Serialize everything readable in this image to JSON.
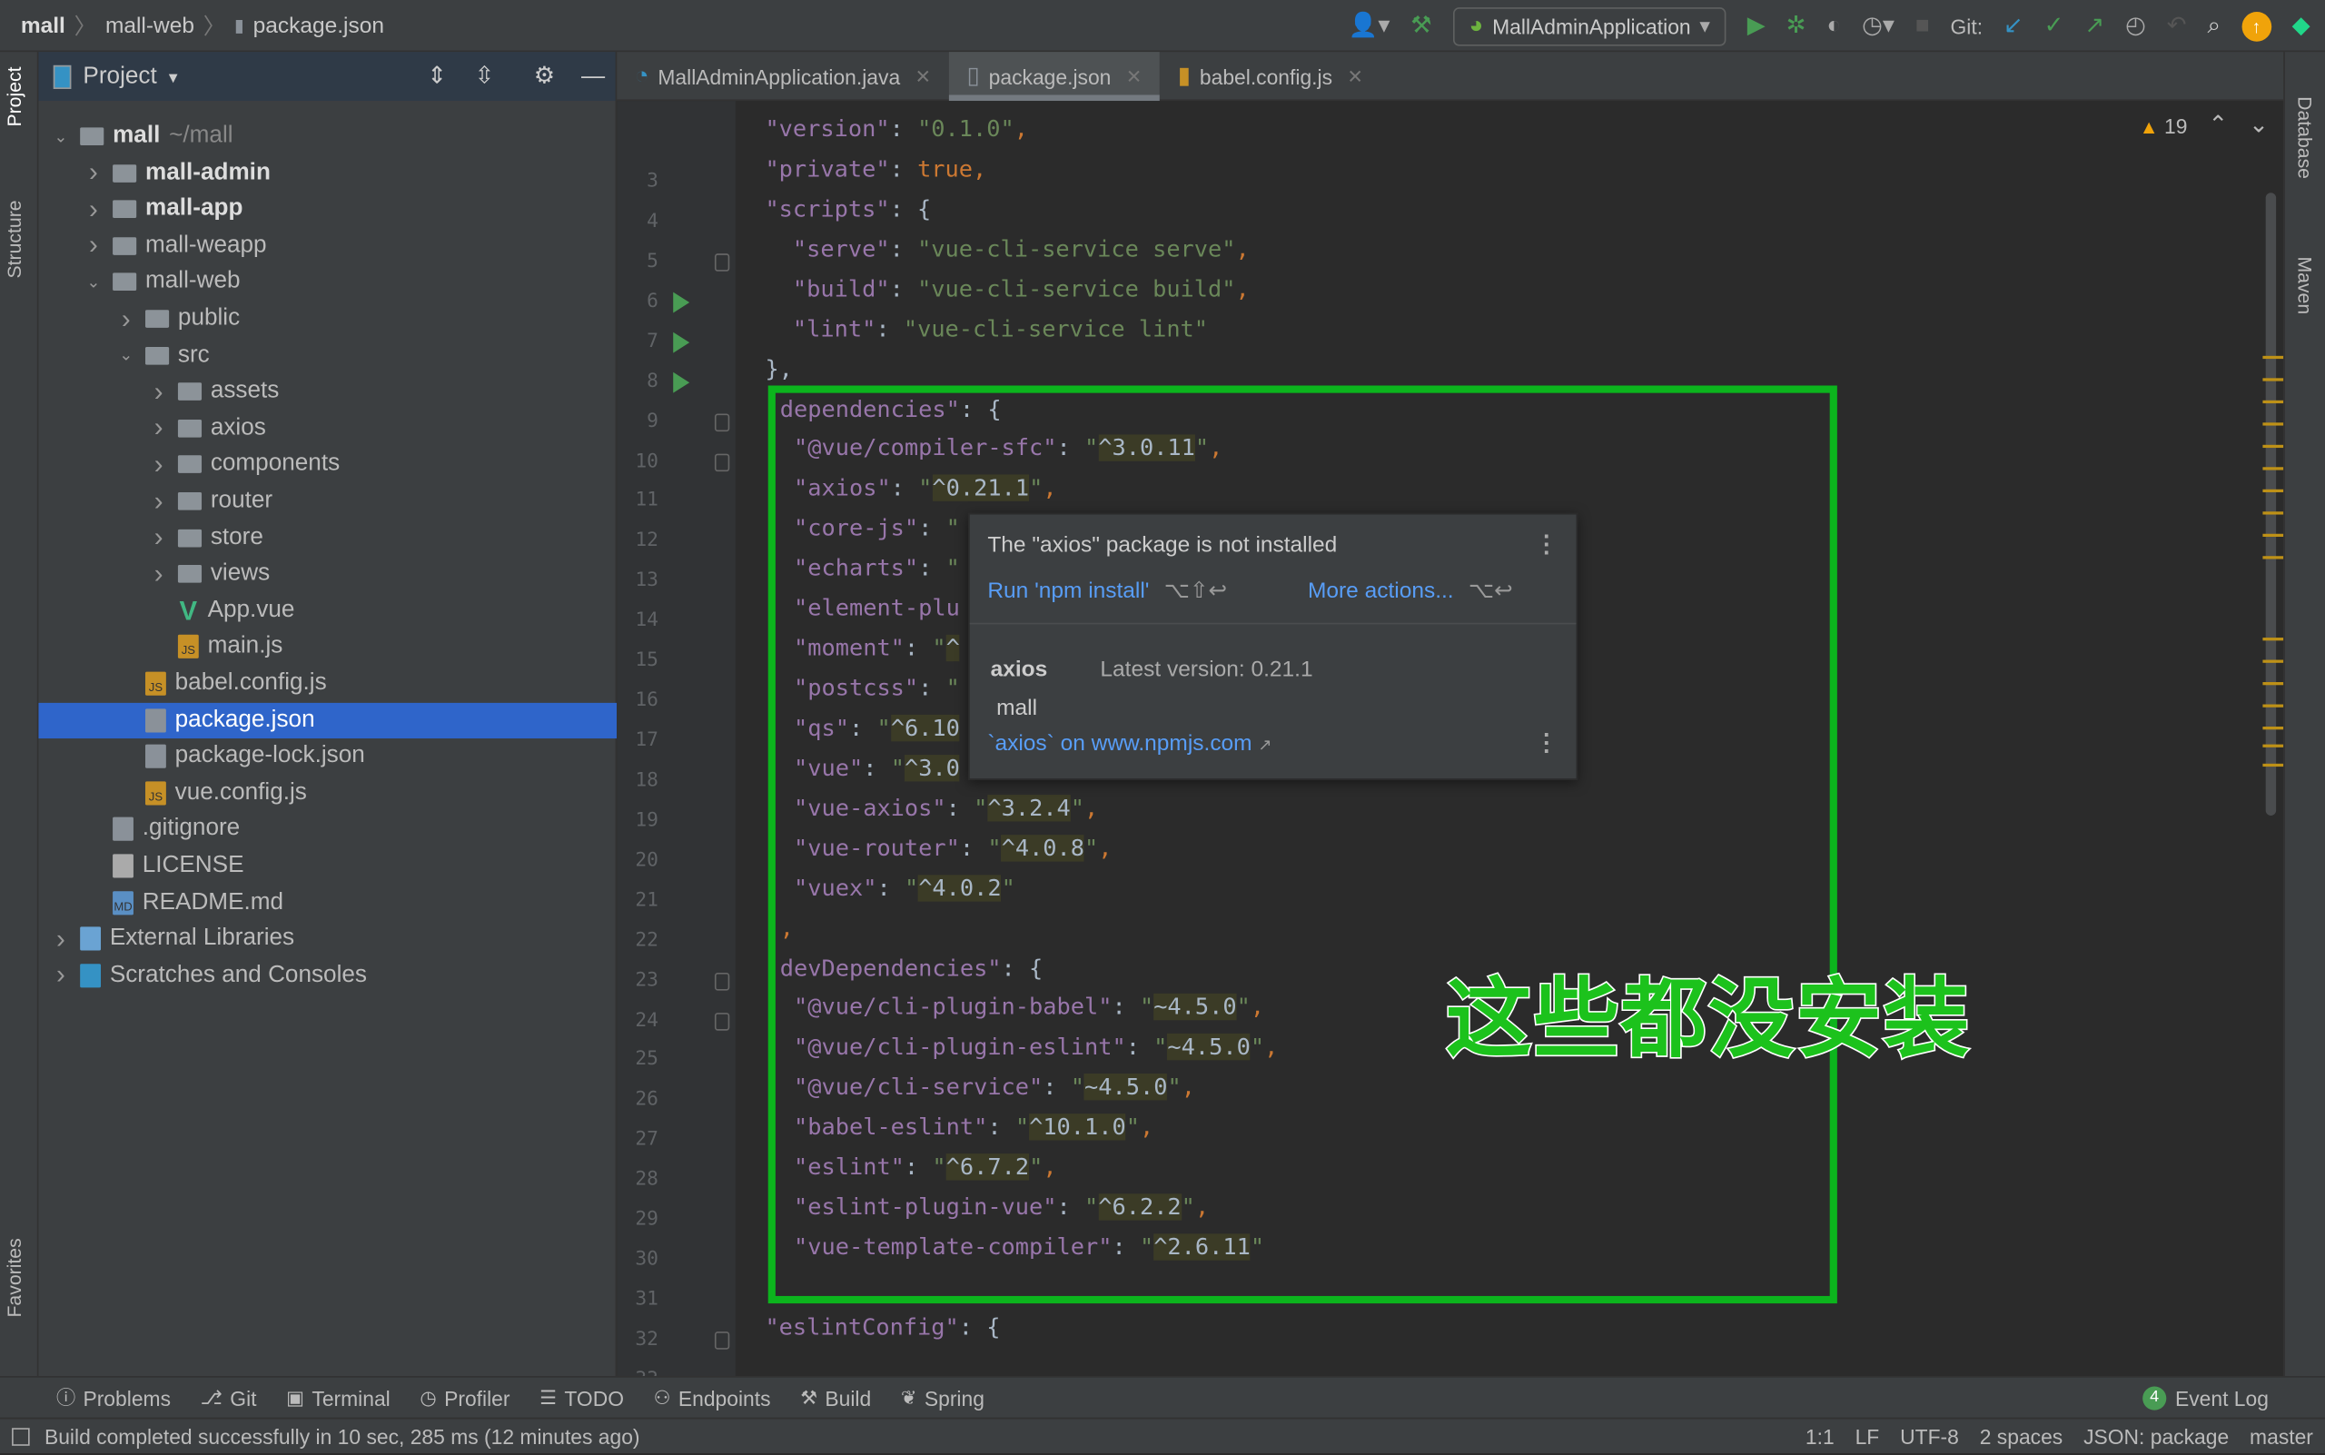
{
  "breadcrumb": [
    "mall",
    "mall-web",
    "package.json"
  ],
  "toolbar": {
    "run_config": "MallAdminApplication",
    "git_label": "Git:"
  },
  "left_tool_tabs": [
    "Project",
    "Structure",
    "Favorites"
  ],
  "right_tool_tabs": [
    "Database",
    "Maven"
  ],
  "project_panel": {
    "title": "Project",
    "items": [
      {
        "label": "mall",
        "extra": "~/mall",
        "depth": 0,
        "arrow": "open",
        "icon": "folder",
        "bold": true
      },
      {
        "label": "mall-admin",
        "depth": 1,
        "arrow": "closed",
        "icon": "folder",
        "bold": true
      },
      {
        "label": "mall-app",
        "depth": 1,
        "arrow": "closed",
        "icon": "folder",
        "bold": true
      },
      {
        "label": "mall-weapp",
        "depth": 1,
        "arrow": "closed",
        "icon": "folder"
      },
      {
        "label": "mall-web",
        "depth": 1,
        "arrow": "open",
        "icon": "folder"
      },
      {
        "label": "public",
        "depth": 2,
        "arrow": "closed",
        "icon": "folder"
      },
      {
        "label": "src",
        "depth": 2,
        "arrow": "open",
        "icon": "folder"
      },
      {
        "label": "assets",
        "depth": 3,
        "arrow": "closed",
        "icon": "folder"
      },
      {
        "label": "axios",
        "depth": 3,
        "arrow": "closed",
        "icon": "folder"
      },
      {
        "label": "components",
        "depth": 3,
        "arrow": "closed",
        "icon": "folder"
      },
      {
        "label": "router",
        "depth": 3,
        "arrow": "closed",
        "icon": "folder"
      },
      {
        "label": "store",
        "depth": 3,
        "arrow": "closed",
        "icon": "folder"
      },
      {
        "label": "views",
        "depth": 3,
        "arrow": "closed",
        "icon": "folder"
      },
      {
        "label": "App.vue",
        "depth": 3,
        "icon": "vue"
      },
      {
        "label": "main.js",
        "depth": 3,
        "icon": "js"
      },
      {
        "label": "babel.config.js",
        "depth": 2,
        "icon": "js"
      },
      {
        "label": "package.json",
        "depth": 2,
        "icon": "json",
        "selected": true
      },
      {
        "label": "package-lock.json",
        "depth": 2,
        "icon": "json"
      },
      {
        "label": "vue.config.js",
        "depth": 2,
        "icon": "js"
      },
      {
        "label": ".gitignore",
        "depth": 1,
        "icon": "ignore"
      },
      {
        "label": "LICENSE",
        "depth": 1,
        "icon": "text"
      },
      {
        "label": "README.md",
        "depth": 1,
        "icon": "md"
      },
      {
        "label": "External Libraries",
        "depth": 0,
        "arrow": "closed",
        "icon": "library"
      },
      {
        "label": "Scratches and Consoles",
        "depth": 0,
        "arrow": "closed",
        "icon": "scratch"
      }
    ]
  },
  "editor_tabs": [
    {
      "label": "MallAdminApplication.java",
      "icon": "java"
    },
    {
      "label": "package.json",
      "icon": "json",
      "active": true
    },
    {
      "label": "babel.config.js",
      "icon": "js"
    }
  ],
  "warnings_count": "19",
  "code_lines": [
    {
      "n": 3,
      "t": [
        [
          "k",
          "\"version\""
        ],
        [
          "p",
          ": "
        ],
        [
          "s",
          "\"0.1.0\""
        ],
        [
          "o",
          ","
        ]
      ]
    },
    {
      "n": 4,
      "t": [
        [
          "k",
          "\"private\""
        ],
        [
          "p",
          ": "
        ],
        [
          "b",
          "true"
        ],
        [
          "o",
          ","
        ]
      ]
    },
    {
      "n": 5,
      "fold": true,
      "t": [
        [
          "k",
          "\"scripts\""
        ],
        [
          "p",
          ": {"
        ]
      ]
    },
    {
      "n": 6,
      "run": true,
      "t": [
        [
          "p",
          "  "
        ],
        [
          "k",
          "\"serve\""
        ],
        [
          "p",
          ": "
        ],
        [
          "s",
          "\"vue-cli-service serve\""
        ],
        [
          "o",
          ","
        ]
      ]
    },
    {
      "n": 7,
      "run": true,
      "t": [
        [
          "p",
          "  "
        ],
        [
          "k",
          "\"build\""
        ],
        [
          "p",
          ": "
        ],
        [
          "s",
          "\"vue-cli-service build\""
        ],
        [
          "o",
          ","
        ]
      ]
    },
    {
      "n": 8,
      "run": true,
      "t": [
        [
          "p",
          "  "
        ],
        [
          "k",
          "\"lint\""
        ],
        [
          "p",
          ": "
        ],
        [
          "s",
          "\"vue-cli-service lint\""
        ]
      ]
    },
    {
      "n": 9,
      "fold": true,
      "t": [
        [
          "p",
          "},"
        ]
      ]
    },
    {
      "n": 10,
      "fold": true,
      "t": [
        [
          "k",
          "dependencies\""
        ],
        [
          "p",
          ": {"
        ]
      ]
    },
    {
      "n": 11,
      "t": [
        [
          "p",
          " "
        ],
        [
          "k",
          "\"@vue/compiler-sfc\""
        ],
        [
          "p",
          ": "
        ],
        [
          "s",
          "\""
        ],
        [
          "h",
          "^3.0.11"
        ],
        [
          "s",
          "\""
        ],
        [
          "o",
          ","
        ]
      ]
    },
    {
      "n": 12,
      "t": [
        [
          "p",
          " "
        ],
        [
          "k",
          "\"axios\""
        ],
        [
          "p",
          ": "
        ],
        [
          "s",
          "\""
        ],
        [
          "h",
          "^0.21.1"
        ],
        [
          "s",
          "\""
        ],
        [
          "o",
          ","
        ]
      ]
    },
    {
      "n": 13,
      "t": [
        [
          "p",
          " "
        ],
        [
          "k",
          "\"core-js\""
        ],
        [
          "p",
          ": "
        ],
        [
          "s",
          "\""
        ]
      ]
    },
    {
      "n": 14,
      "t": [
        [
          "p",
          " "
        ],
        [
          "k",
          "\"echarts\""
        ],
        [
          "p",
          ": "
        ],
        [
          "s",
          "\""
        ]
      ]
    },
    {
      "n": 15,
      "t": [
        [
          "p",
          " "
        ],
        [
          "k",
          "\"element-plu"
        ]
      ]
    },
    {
      "n": 16,
      "t": [
        [
          "p",
          " "
        ],
        [
          "k",
          "\"moment\""
        ],
        [
          "p",
          ": "
        ],
        [
          "s",
          "\""
        ],
        [
          "h",
          "^"
        ]
      ]
    },
    {
      "n": 17,
      "t": [
        [
          "p",
          " "
        ],
        [
          "k",
          "\"postcss\""
        ],
        [
          "p",
          ": "
        ],
        [
          "s",
          "\""
        ]
      ]
    },
    {
      "n": 18,
      "t": [
        [
          "p",
          " "
        ],
        [
          "k",
          "\"qs\""
        ],
        [
          "p",
          ": "
        ],
        [
          "s",
          "\""
        ],
        [
          "h",
          "^6.10"
        ]
      ]
    },
    {
      "n": 19,
      "t": [
        [
          "p",
          " "
        ],
        [
          "k",
          "\"vue\""
        ],
        [
          "p",
          ": "
        ],
        [
          "s",
          "\""
        ],
        [
          "h",
          "^3.0"
        ]
      ]
    },
    {
      "n": 20,
      "t": [
        [
          "p",
          " "
        ],
        [
          "k",
          "\"vue-axios\""
        ],
        [
          "p",
          ": "
        ],
        [
          "s",
          "\""
        ],
        [
          "h",
          "^3.2.4"
        ],
        [
          "s",
          "\""
        ],
        [
          "o",
          ","
        ]
      ]
    },
    {
      "n": 21,
      "t": [
        [
          "p",
          " "
        ],
        [
          "k",
          "\"vue-router\""
        ],
        [
          "p",
          ": "
        ],
        [
          "s",
          "\""
        ],
        [
          "h",
          "^4.0.8"
        ],
        [
          "s",
          "\""
        ],
        [
          "o",
          ","
        ]
      ]
    },
    {
      "n": 22,
      "t": [
        [
          "p",
          " "
        ],
        [
          "k",
          "\"vuex\""
        ],
        [
          "p",
          ": "
        ],
        [
          "s",
          "\""
        ],
        [
          "h",
          "^4.0.2"
        ],
        [
          "s",
          "\""
        ]
      ]
    },
    {
      "n": 23,
      "fold": true,
      "t": [
        [
          "o",
          ","
        ]
      ]
    },
    {
      "n": 24,
      "fold": true,
      "t": [
        [
          "k",
          "devDependencies\""
        ],
        [
          "p",
          ": {"
        ]
      ]
    },
    {
      "n": 25,
      "t": [
        [
          "p",
          " "
        ],
        [
          "k",
          "\"@vue/cli-plugin-babel\""
        ],
        [
          "p",
          ": "
        ],
        [
          "s",
          "\""
        ],
        [
          "h",
          "~4.5.0"
        ],
        [
          "s",
          "\""
        ],
        [
          "o",
          ","
        ]
      ]
    },
    {
      "n": 26,
      "t": [
        [
          "p",
          " "
        ],
        [
          "k",
          "\"@vue/cli-plugin-eslint\""
        ],
        [
          "p",
          ": "
        ],
        [
          "s",
          "\""
        ],
        [
          "h",
          "~4.5.0"
        ],
        [
          "s",
          "\""
        ],
        [
          "o",
          ","
        ]
      ]
    },
    {
      "n": 27,
      "t": [
        [
          "p",
          " "
        ],
        [
          "k",
          "\"@vue/cli-service\""
        ],
        [
          "p",
          ": "
        ],
        [
          "s",
          "\""
        ],
        [
          "h",
          "~4.5.0"
        ],
        [
          "s",
          "\""
        ],
        [
          "o",
          ","
        ]
      ]
    },
    {
      "n": 28,
      "t": [
        [
          "p",
          " "
        ],
        [
          "k",
          "\"babel-eslint\""
        ],
        [
          "p",
          ": "
        ],
        [
          "s",
          "\""
        ],
        [
          "h",
          "^10.1.0"
        ],
        [
          "s",
          "\""
        ],
        [
          "o",
          ","
        ]
      ]
    },
    {
      "n": 29,
      "t": [
        [
          "p",
          " "
        ],
        [
          "k",
          "\"eslint\""
        ],
        [
          "p",
          ": "
        ],
        [
          "s",
          "\""
        ],
        [
          "h",
          "^6.7.2"
        ],
        [
          "s",
          "\""
        ],
        [
          "o",
          ","
        ]
      ]
    },
    {
      "n": 30,
      "t": [
        [
          "p",
          " "
        ],
        [
          "k",
          "\"eslint-plugin-vue\""
        ],
        [
          "p",
          ": "
        ],
        [
          "s",
          "\""
        ],
        [
          "h",
          "^6.2.2"
        ],
        [
          "s",
          "\""
        ],
        [
          "o",
          ","
        ]
      ]
    },
    {
      "n": 31,
      "t": [
        [
          "p",
          " "
        ],
        [
          "k",
          "\"vue-template-compiler\""
        ],
        [
          "p",
          ": "
        ],
        [
          "s",
          "\""
        ],
        [
          "h",
          "^2.6.11"
        ],
        [
          "s",
          "\""
        ]
      ]
    },
    {
      "n": 32,
      "fold": true,
      "t": []
    },
    {
      "n": 33,
      "t": [
        [
          "k",
          "\"eslintConfig\""
        ],
        [
          "p",
          ": {"
        ]
      ]
    }
  ],
  "popup": {
    "title": "The \"axios\" package is not installed",
    "action1": "Run 'npm install'",
    "action1_keys": "⌥⇧↩",
    "action2": "More actions...",
    "action2_keys": "⌥↩",
    "package": "axios",
    "latest": "Latest version: 0.21.1",
    "project": "mall",
    "link": "`axios` on www.npmjs.com"
  },
  "annotation": {
    "text": "这些都没安装",
    "color": "#0cb41d"
  },
  "tool_windows": [
    "Problems",
    "Git",
    "Terminal",
    "Profiler",
    "TODO",
    "Endpoints",
    "Build",
    "Spring"
  ],
  "event_log": {
    "count": "4",
    "label": "Event Log"
  },
  "status": {
    "message": "Build completed successfully in 10 sec, 285 ms (12 minutes ago)",
    "position": "1:1",
    "line_sep": "LF",
    "encoding": "UTF-8",
    "indent": "2 spaces",
    "schema": "JSON: package",
    "branch": "master"
  }
}
